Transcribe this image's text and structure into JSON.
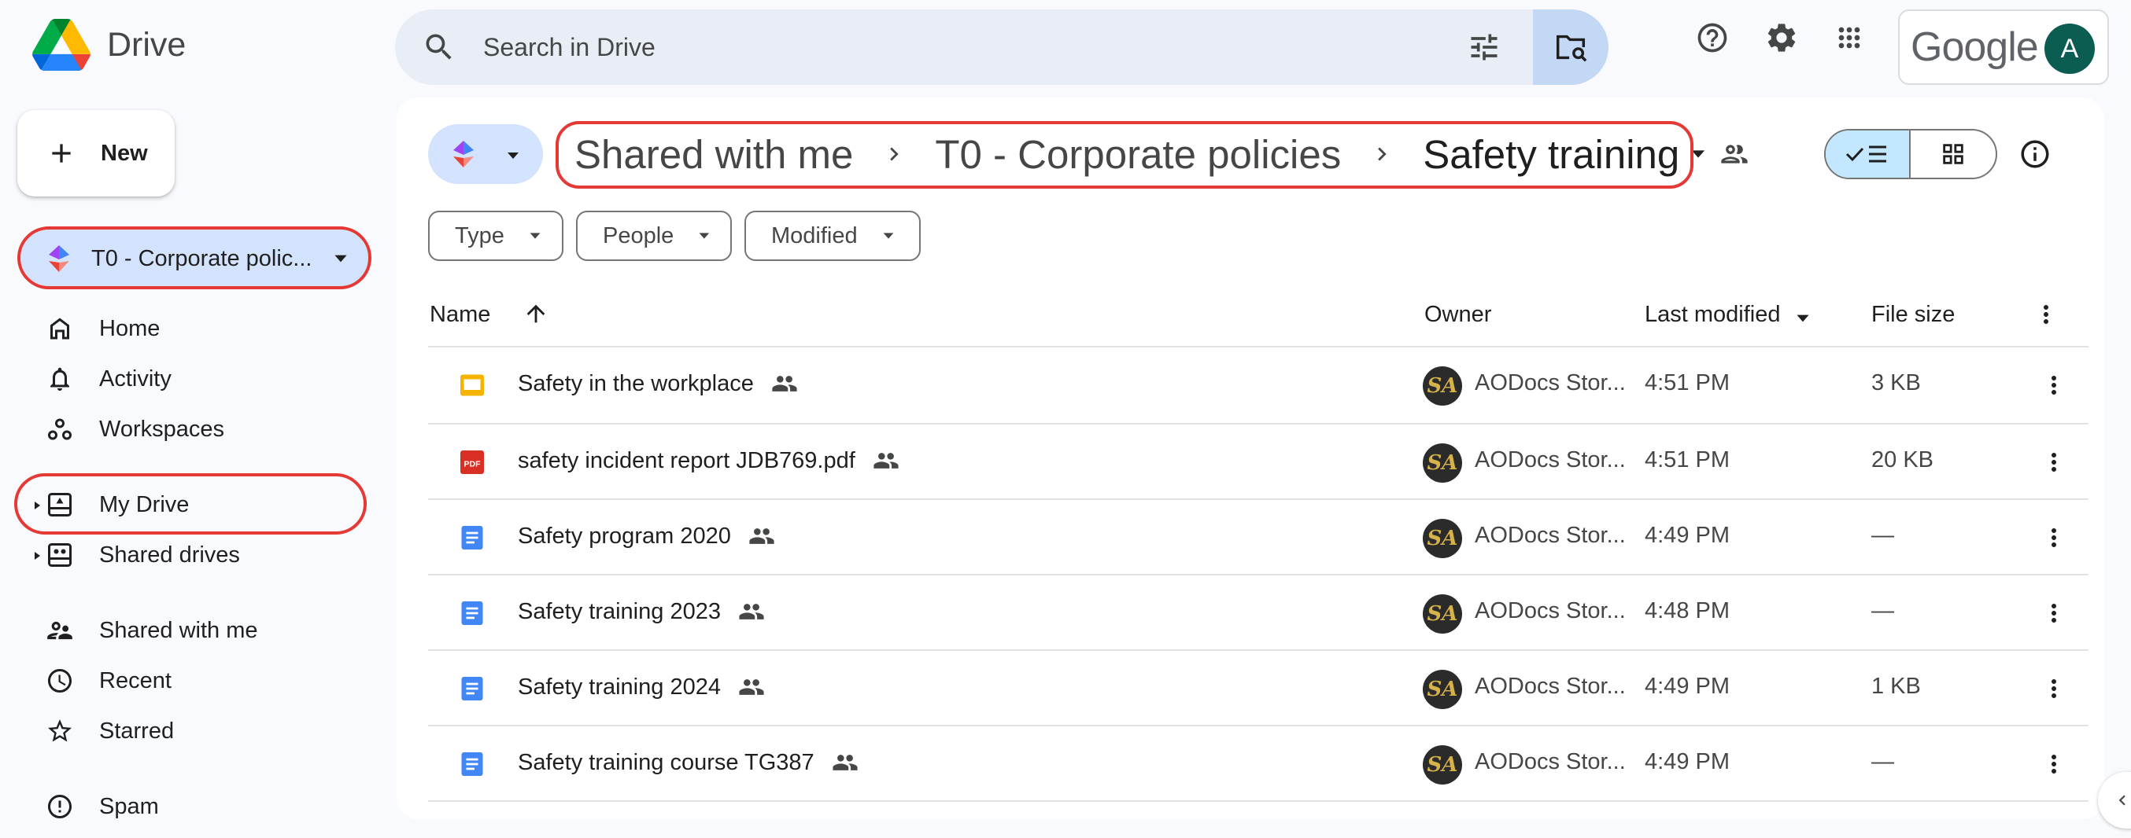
{
  "app": {
    "name": "Drive"
  },
  "search": {
    "placeholder": "Search in Drive"
  },
  "account": {
    "brand": "Google",
    "avatar_initial": "A",
    "avatar_color": "#0b5d51"
  },
  "sidebar": {
    "new_label": "New",
    "library_selector": "T0 - Corporate polic...",
    "nav": {
      "home": "Home",
      "activity": "Activity",
      "workspaces": "Workspaces",
      "my_drive": "My Drive",
      "shared_drives": "Shared drives",
      "shared_with_me": "Shared with me",
      "recent": "Recent",
      "starred": "Starred",
      "spam": "Spam"
    }
  },
  "breadcrumb": [
    "Shared with me",
    "T0 - Corporate policies",
    "Safety training"
  ],
  "filters": {
    "type": "Type",
    "people": "People",
    "modified": "Modified"
  },
  "table": {
    "headers": {
      "name": "Name",
      "owner": "Owner",
      "last_modified": "Last modified",
      "file_size": "File size"
    },
    "rows": [
      {
        "name": "Safety in the workplace",
        "type": "slides",
        "owner": "AODocs Stor...",
        "modified": "4:51 PM",
        "size": "3 KB"
      },
      {
        "name": "safety incident report JDB769.pdf",
        "type": "pdf",
        "owner": "AODocs Stor...",
        "modified": "4:51 PM",
        "size": "20 KB"
      },
      {
        "name": "Safety program 2020",
        "type": "doc",
        "owner": "AODocs Stor...",
        "modified": "4:49 PM",
        "size": "—"
      },
      {
        "name": "Safety training 2023",
        "type": "doc",
        "owner": "AODocs Stor...",
        "modified": "4:48 PM",
        "size": "—"
      },
      {
        "name": "Safety training 2024",
        "type": "doc",
        "owner": "AODocs Stor...",
        "modified": "4:49 PM",
        "size": "1 KB"
      },
      {
        "name": "Safety training course TG387",
        "type": "doc",
        "owner": "AODocs Stor...",
        "modified": "4:49 PM",
        "size": "—"
      }
    ],
    "owner_avatar_text": "SA"
  },
  "colors": {
    "accent": "#d3e3fd",
    "highlight": "#e53935",
    "pdf": "#d93025",
    "doc": "#4285f4",
    "slides": "#f4b400"
  }
}
